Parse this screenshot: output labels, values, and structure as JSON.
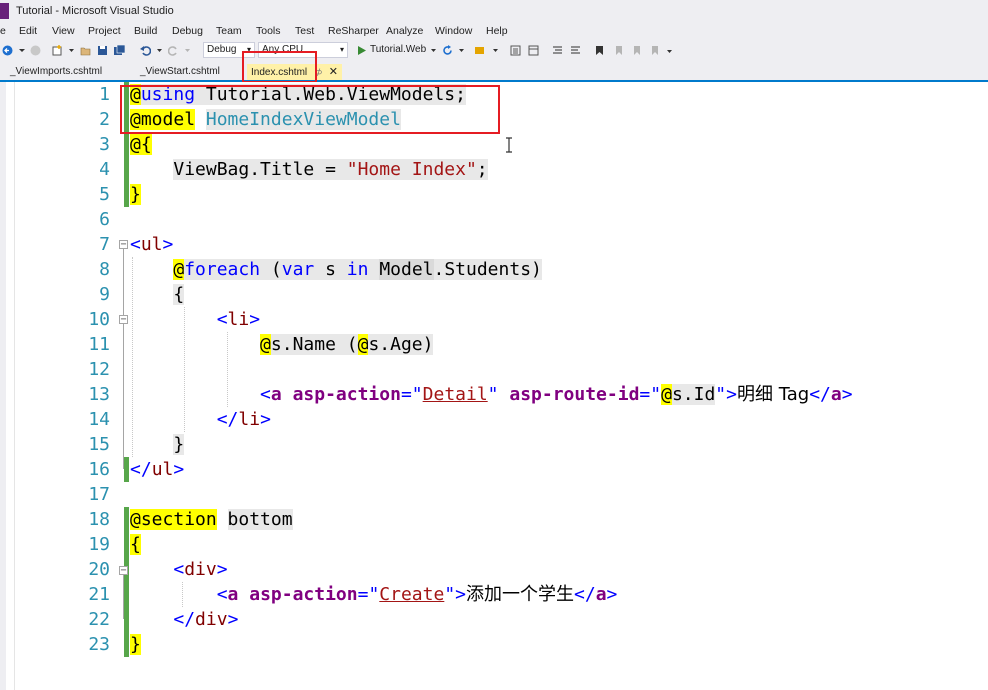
{
  "window": {
    "title": "Tutorial - Microsoft Visual Studio"
  },
  "menu": [
    "Edit",
    "View",
    "Project",
    "Build",
    "Debug",
    "Team",
    "Tools",
    "Test",
    "ReSharper",
    "Analyze",
    "Window",
    "Help"
  ],
  "toolbar": {
    "config": "Debug",
    "platform": "Any CPU",
    "start_label": "Tutorial.Web"
  },
  "tabs": [
    {
      "label": "_ViewImports.cshtml",
      "active": false
    },
    {
      "label": "_ViewStart.cshtml",
      "active": false
    },
    {
      "label": "Index.cshtml",
      "active": true
    }
  ],
  "editor": {
    "line_numbers": [
      "1",
      "2",
      "3",
      "4",
      "5",
      "6",
      "7",
      "8",
      "9",
      "10",
      "11",
      "12",
      "13",
      "14",
      "15",
      "16",
      "17",
      "18",
      "19",
      "20",
      "21",
      "22",
      "23"
    ],
    "lines": {
      "l1": {
        "at": "@",
        "kw": "using",
        "rest": " Tutorial.Web.ViewModels;"
      },
      "l2": {
        "at": "@",
        "kw": "model",
        "sp": " ",
        "cls": "HomeIndexViewModel"
      },
      "l3": {
        "at": "@",
        "brace": "{"
      },
      "l4": {
        "pre": "    ",
        "text": "ViewBag.Title = ",
        "str": "\"Home Index\"",
        "semi": ";"
      },
      "l5": {
        "brace": "}"
      },
      "l7": {
        "open": "<",
        "tag": "ul",
        "close": ">"
      },
      "l8": {
        "pre": "    ",
        "at": "@",
        "kw": "foreach",
        "p1": " (",
        "kw2": "var",
        "p2": " s ",
        "kw3": "in",
        "p3": " ",
        "model": "Model",
        "rest": ".Students)"
      },
      "l9": {
        "pre": "    ",
        "brace": "{"
      },
      "l10": {
        "pre": "        ",
        "open": "<",
        "tag": "li",
        "close": ">"
      },
      "l11": {
        "pre": "            ",
        "at1": "@",
        "t1": "s.Name (",
        "at2": "@",
        "t2": "s.Age)"
      },
      "l13": {
        "pre": "            ",
        "open": "<",
        "tag": "a",
        "sp1": " ",
        "attr1": "asp-action",
        "eq1": "=",
        "q1": "\"",
        "val1": "Detail",
        "q2": "\"",
        "sp2": " ",
        "attr2": "asp-route-id",
        "eq2": "=",
        "q3": "\"",
        "at": "@",
        "razor": "s.Id",
        "q4": "\"",
        "gt": ">",
        "text": "明细 Tag",
        "endopen": "</",
        "endtag": "a",
        "endclose": ">"
      },
      "l14": {
        "pre": "        ",
        "open": "</",
        "tag": "li",
        "close": ">"
      },
      "l15": {
        "pre": "    ",
        "brace": "}"
      },
      "l16": {
        "open": "</",
        "tag": "ul",
        "close": ">"
      },
      "l18": {
        "at": "@",
        "kw": "section",
        "sp": " ",
        "name": "bottom"
      },
      "l19": {
        "brace": "{"
      },
      "l20": {
        "pre": "    ",
        "open": "<",
        "tag": "div",
        "close": ">"
      },
      "l21": {
        "pre": "        ",
        "open": "<",
        "tag": "a",
        "sp1": " ",
        "attr1": "asp-action",
        "eq1": "=",
        "q1": "\"",
        "val1": "Create",
        "q2": "\"",
        "gt": ">",
        "text": "添加一个学生",
        "endopen": "</",
        "endtag": "a",
        "endclose": ">"
      },
      "l22": {
        "pre": "    ",
        "open": "</",
        "tag": "div",
        "close": ">"
      },
      "l23": {
        "brace": "}"
      }
    }
  },
  "colors": {
    "keyword": "#0000ff",
    "tag": "#800000",
    "attribute": "#800080",
    "string": "#a31515",
    "type": "#2b91af",
    "razor_at_highlight": "#ffff00",
    "line_number": "#2b91af",
    "changed_margin": "#57a64a",
    "annotation_box": "#e51c23",
    "active_tab": "#fff1a8"
  }
}
